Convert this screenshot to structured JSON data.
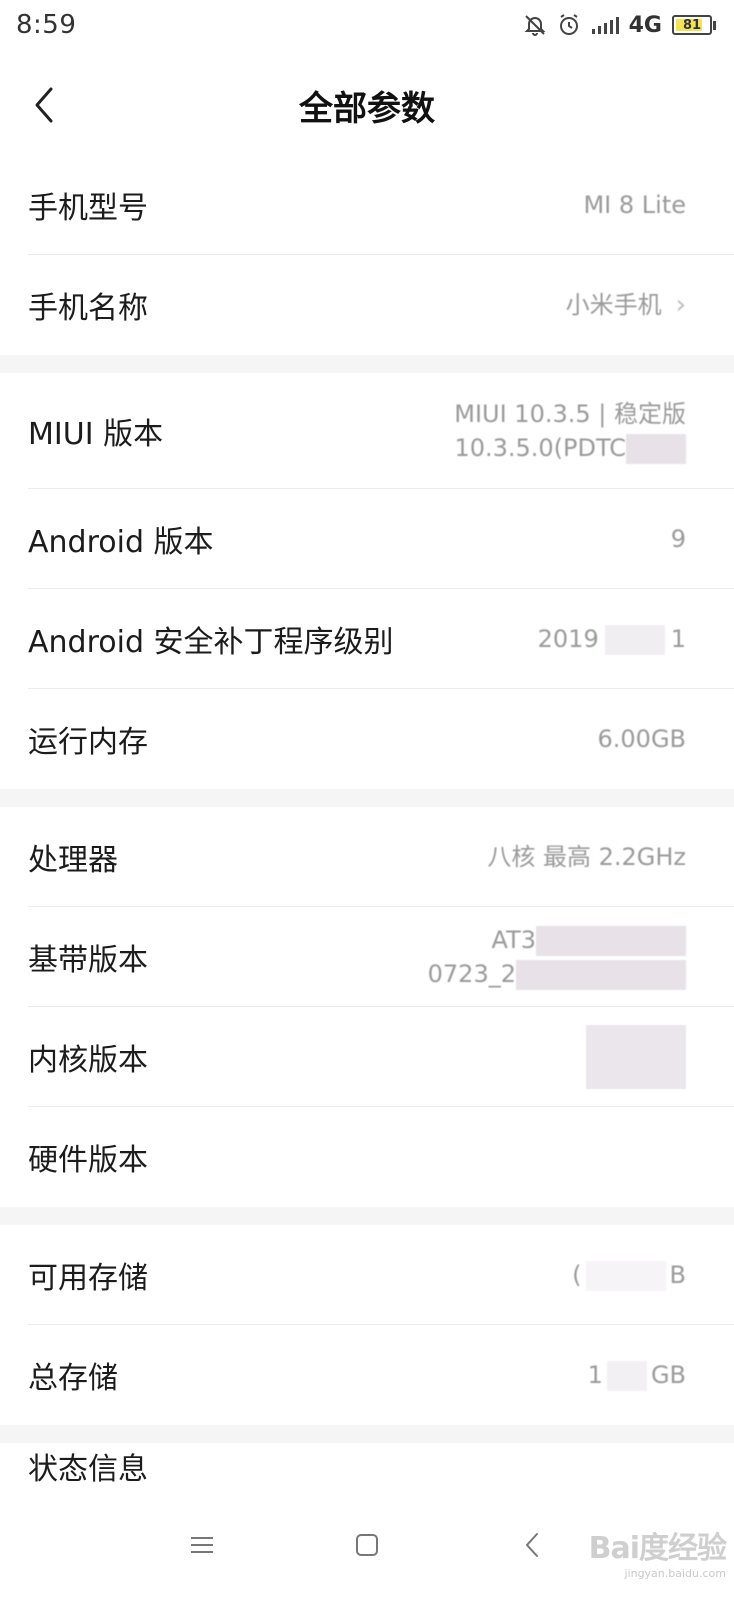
{
  "status_bar": {
    "time": "8:59",
    "network": "4G",
    "battery": "81",
    "battery_level": 0.81,
    "icons": [
      "mute-bell-icon",
      "alarm-icon",
      "signal-icon",
      "battery-icon"
    ]
  },
  "header": {
    "title": "全部参数",
    "back_icon": "back-arrow-icon"
  },
  "rows": {
    "model": {
      "label": "手机型号",
      "value": "MI 8 Lite"
    },
    "name": {
      "label": "手机名称",
      "value": "小米手机"
    },
    "miui": {
      "label": "MIUI 版本",
      "value_line1": "MIUI 10.3.5 | 稳定版",
      "value_line2": "10.3.5.0(PDTC"
    },
    "android": {
      "label": "Android 版本",
      "value": "9"
    },
    "patch": {
      "label": "Android 安全补丁程序级别",
      "value_a": "2019",
      "value_b": "1"
    },
    "ram": {
      "label": "运行内存",
      "value": "6.00GB"
    },
    "cpu": {
      "label": "处理器",
      "value": "八核 最高 2.2GHz"
    },
    "baseband": {
      "label": "基带版本",
      "value_line1": "AT3",
      "value_line2": "0723_2"
    },
    "kernel": {
      "label": "内核版本"
    },
    "hardware": {
      "label": "硬件版本"
    },
    "avail_storage": {
      "label": "可用存储",
      "value_a": "(",
      "value_b": "B"
    },
    "total_storage": {
      "label": "总存储",
      "value_a": "1",
      "value_b": "GB"
    },
    "status": {
      "label": "状态信息"
    }
  },
  "watermark": {
    "brand": "Bai度经验",
    "url": "jingyan.baidu.com"
  }
}
